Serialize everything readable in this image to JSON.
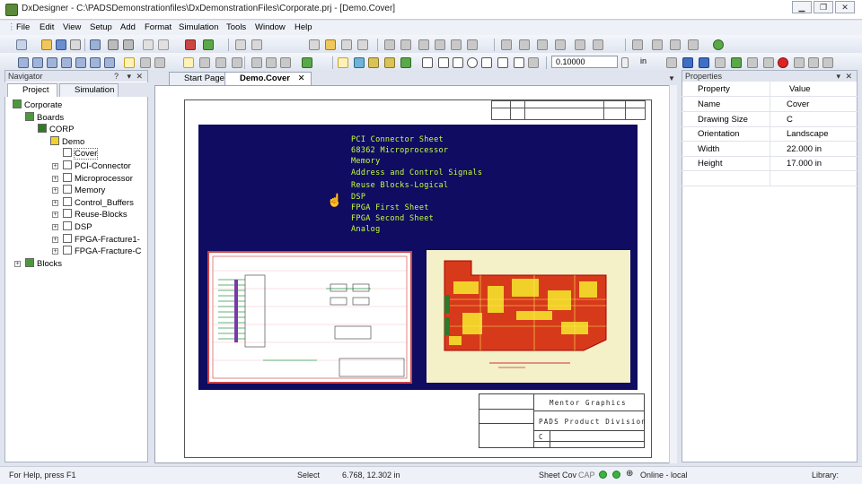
{
  "window": {
    "title": "DxDesigner - C:\\PADSDemonstrationfiles\\DxDemonstrationFiles\\Corporate.prj - [Demo.Cover]",
    "controls": [
      "minimize",
      "restore",
      "close"
    ]
  },
  "menu": [
    "File",
    "Edit",
    "View",
    "Setup",
    "Add",
    "Format",
    "Simulation",
    "Tools",
    "Window",
    "Help"
  ],
  "toolbar": {
    "zoom_value": "0.10000",
    "zoom_unit": "in"
  },
  "navigator": {
    "title": "Navigator",
    "header_buttons": [
      "?",
      "▾",
      "✕"
    ],
    "tabs": [
      "Project",
      "Simulation"
    ],
    "active_tab": "Project",
    "tree": [
      {
        "label": "Corporate",
        "level": 0,
        "icon": "project-icon"
      },
      {
        "label": "Boards",
        "level": 1,
        "icon": "boards-icon"
      },
      {
        "label": "CORP",
        "level": 2,
        "icon": "board-icon"
      },
      {
        "label": "Demo",
        "level": 3,
        "icon": "schematic-icon"
      },
      {
        "label": "Cover",
        "level": 4,
        "icon": "sheet-icon",
        "selected": true
      },
      {
        "label": "PCI-Connector",
        "level": 4,
        "icon": "sheet-icon"
      },
      {
        "label": "Microprocessor",
        "level": 4,
        "icon": "sheet-icon"
      },
      {
        "label": "Memory",
        "level": 4,
        "icon": "sheet-icon"
      },
      {
        "label": "Control_Buffers",
        "level": 4,
        "icon": "sheet-icon"
      },
      {
        "label": "Reuse-Blocks",
        "level": 4,
        "icon": "sheet-icon"
      },
      {
        "label": "DSP",
        "level": 4,
        "icon": "sheet-icon"
      },
      {
        "label": "FPGA-Fracture1-",
        "level": 4,
        "icon": "sheet-icon"
      },
      {
        "label": "FPGA-Fracture-C",
        "level": 4,
        "icon": "sheet-icon"
      },
      {
        "label": "Blocks",
        "level": 1,
        "icon": "blocks-icon"
      }
    ]
  },
  "doc_tabs": [
    {
      "label": "Start Page",
      "active": false
    },
    {
      "label": "Demo.Cover",
      "active": true,
      "close": "✕"
    }
  ],
  "sheet": {
    "cover_lines": [
      "PCI Connector Sheet",
      "68362 Microprocessor",
      "Memory",
      "Address and Control Signals",
      "Reuse Blocks-Logical",
      "DSP",
      "FPGA First Sheet",
      "FPGA Second Sheet",
      "Analog"
    ],
    "title_block": {
      "company": "Mentor Graphics",
      "division": "PADS Product Division",
      "size": "C"
    }
  },
  "properties": {
    "title": "Properties",
    "header_buttons": [
      "▾",
      "✕"
    ],
    "columns": [
      "Property",
      "Value"
    ],
    "rows": [
      {
        "name": "Name",
        "value": "Cover"
      },
      {
        "name": "Drawing Size",
        "value": "C"
      },
      {
        "name": "Orientation",
        "value": "Landscape"
      },
      {
        "name": "Width",
        "value": "22.000 in"
      },
      {
        "name": "Height",
        "value": "17.000 in"
      }
    ]
  },
  "status": {
    "help": "For Help, press F1",
    "mode": "Select",
    "coords": "6.768, 12.302 in",
    "sheet": "Sheet Cov",
    "caps": "CAP",
    "online": "Online - local",
    "library": "Library:"
  }
}
